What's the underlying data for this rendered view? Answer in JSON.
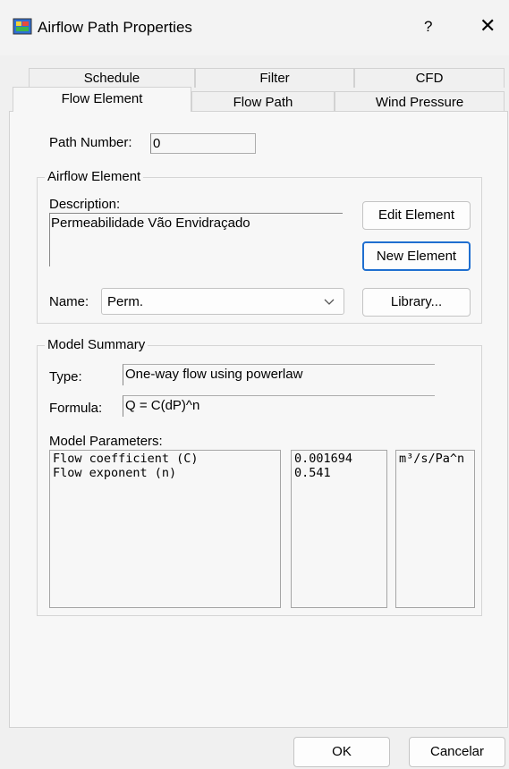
{
  "window": {
    "title": "Airflow Path Properties",
    "help": "?",
    "close": "✕"
  },
  "tabs": {
    "row_top": [
      "Schedule",
      "Filter",
      "CFD"
    ],
    "row_bottom": [
      "Flow Element",
      "Flow Path",
      "Wind Pressure"
    ],
    "active": "Flow Element"
  },
  "path_number": {
    "label": "Path Number:",
    "value": "0"
  },
  "airflow_element": {
    "group_label": "Airflow Element",
    "description_label": "Description:",
    "description_value": "Permeabilidade Vão Envidraçado",
    "name_label": "Name:",
    "name_value": "Perm.",
    "edit_button": "Edit Element",
    "new_button": "New Element",
    "library_button": "Library..."
  },
  "model_summary": {
    "group_label": "Model Summary",
    "type_label": "Type:",
    "type_value": "One-way flow using powerlaw",
    "formula_label": "Formula:",
    "formula_value": "Q = C(dP)^n",
    "params_label": "Model Parameters:",
    "params": [
      {
        "name": "Flow coefficient (C)",
        "value": "0.001694",
        "unit": "m³/s/Pa^n"
      },
      {
        "name": "Flow exponent (n)",
        "value": "0.541",
        "unit": ""
      }
    ]
  },
  "footer": {
    "ok": "OK",
    "cancel": "Cancelar"
  }
}
